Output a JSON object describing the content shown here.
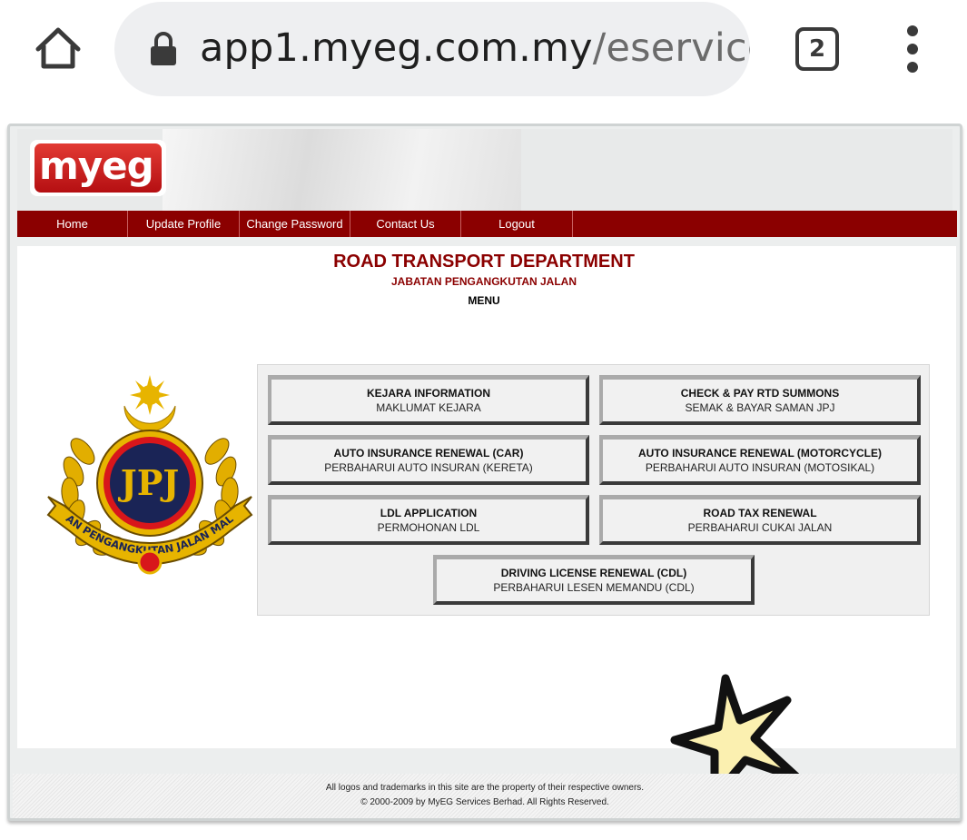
{
  "browser": {
    "url_host": "app1.myeg.com.my",
    "url_path": "/eservice",
    "tab_count": "2",
    "icons": [
      "home-icon",
      "lock-icon",
      "tab-switcher-icon",
      "more-vert-icon"
    ]
  },
  "site": {
    "logo_text": "myeg"
  },
  "nav": {
    "items": [
      {
        "label": "Home"
      },
      {
        "label": "Update Profile"
      },
      {
        "label": "Change Password"
      },
      {
        "label": "Contact Us"
      },
      {
        "label": "Logout"
      }
    ]
  },
  "page": {
    "title": "ROAD TRANSPORT DEPARTMENT",
    "subtitle": "JABATAN PENGANGKUTAN JALAN",
    "menu_label": "MENU",
    "emblem_text": "JPJ",
    "emblem_ribbon": "JABATAN PENGANGKUTAN JALAN MALAYSIA"
  },
  "menu": {
    "buttons": [
      {
        "en": "KEJARA INFORMATION",
        "my": "MAKLUMAT KEJARA"
      },
      {
        "en": "CHECK & PAY RTD SUMMONS",
        "my": "SEMAK & BAYAR SAMAN JPJ"
      },
      {
        "en": "AUTO INSURANCE RENEWAL (CAR)",
        "my": "PERBAHARUI AUTO INSURAN (KERETA)"
      },
      {
        "en": "AUTO INSURANCE RENEWAL (MOTORCYCLE)",
        "my": "PERBAHARUI AUTO INSURAN (MOTOSIKAL)"
      },
      {
        "en": "LDL APPLICATION",
        "my": "PERMOHONAN LDL"
      },
      {
        "en": "ROAD TAX RENEWAL",
        "my": "PERBAHARUI CUKAI JALAN"
      },
      {
        "en": "DRIVING LICENSE RENEWAL (CDL)",
        "my": "PERBAHARUI LESEN MEMANDU (CDL)"
      }
    ]
  },
  "footer": {
    "line1": "All logos and trademarks in this site are the property of their respective owners.",
    "line2": "© 2000-2009 by MyEG Services Berhad. All Rights Reserved."
  },
  "colors": {
    "brand_red": "#8b0000",
    "logo_red": "#d42a24",
    "emblem_gold": "#e7b400",
    "emblem_navy": "#1a2456",
    "star_fill": "#fbf0b0"
  }
}
